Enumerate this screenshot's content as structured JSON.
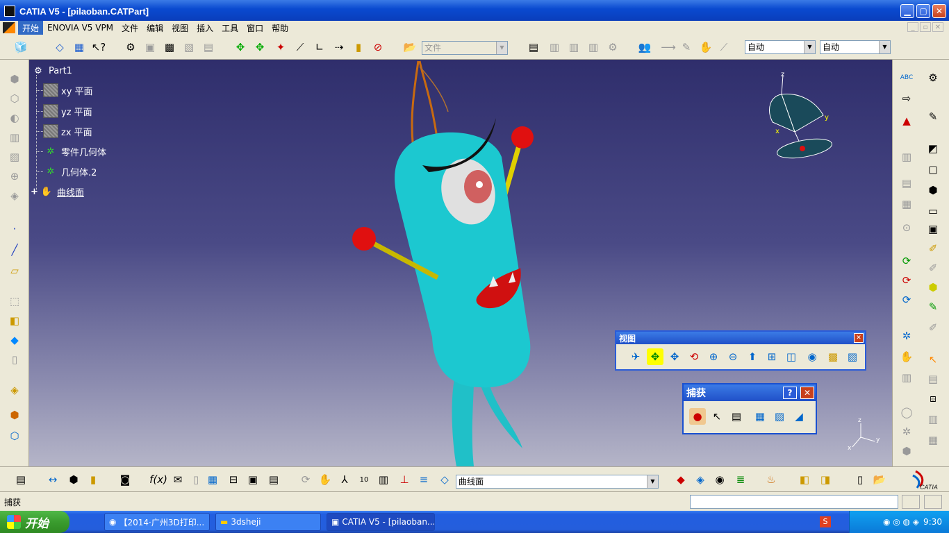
{
  "window": {
    "title": "CATIA V5 - [pilaoban.CATPart]"
  },
  "menubar": {
    "items": [
      "开始",
      "ENOVIA V5 VPM",
      "文件",
      "编辑",
      "视图",
      "插入",
      "工具",
      "窗口",
      "帮助"
    ]
  },
  "toolbar_top": {
    "file_combo": "文件",
    "auto_combo_1": "自动",
    "auto_combo_2": "自动"
  },
  "tree": {
    "root": "Part1",
    "items": [
      "xy 平面",
      "yz 平面",
      "zx 平面",
      "零件几何体",
      "几何体.2",
      "曲线面"
    ]
  },
  "compass": {
    "x_label": "x",
    "y_label": "y",
    "z_label": "z"
  },
  "axis_triad": {
    "x_label": "x",
    "y_label": "y",
    "z_label": "z"
  },
  "view_toolbar": {
    "title": "视图"
  },
  "capture_toolbar": {
    "title": "捕获",
    "help": "?",
    "close": "✕"
  },
  "bottom_toolbar": {
    "combo_value": "曲线面"
  },
  "statusbar": {
    "text": "捕获"
  },
  "taskbar": {
    "start_label": "开始",
    "tasks": [
      "【2014·广州3D打印...",
      "3dsheji",
      "CATIA V5 - [pilaoban...."
    ],
    "clock": "9:30"
  },
  "catia_logo": "CATIA"
}
